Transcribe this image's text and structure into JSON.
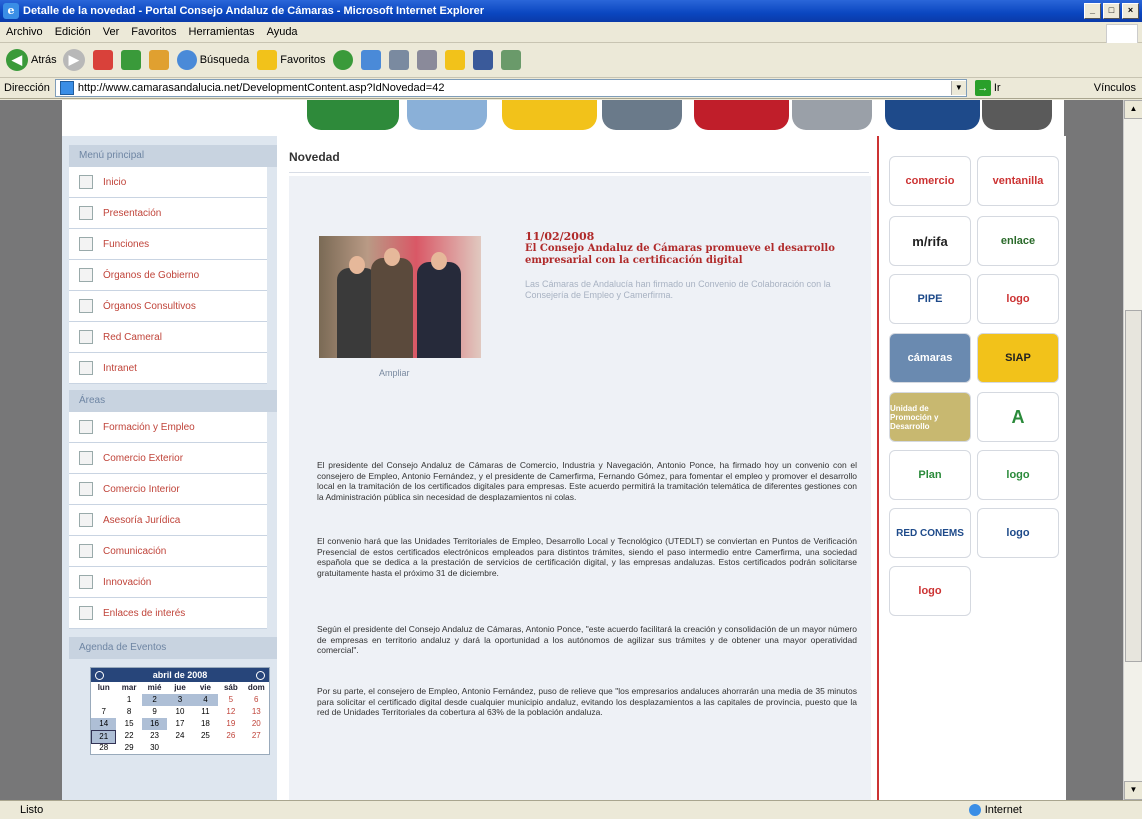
{
  "window": {
    "title": "Detalle de la novedad - Portal Consejo Andaluz de Cámaras - Microsoft Internet Explorer",
    "controls": [
      "_",
      "□",
      "×"
    ]
  },
  "menubar": [
    "Archivo",
    "Edición",
    "Ver",
    "Favoritos",
    "Herramientas",
    "Ayuda"
  ],
  "toolbar": {
    "back": "Atrás",
    "search": "Búsqueda",
    "favorites": "Favoritos"
  },
  "address": {
    "label": "Dirección",
    "url": "http://www.camarasandalucia.net/DevelopmentContent.asp?IdNovedad=42",
    "go": "Ir",
    "links": "Vínculos"
  },
  "sidebar": {
    "main_header": "Menú principal",
    "main_items": [
      {
        "label": "Inicio"
      },
      {
        "label": "Presentación"
      },
      {
        "label": "Funciones"
      },
      {
        "label": "Órganos de Gobierno"
      },
      {
        "label": "Órganos Consultivos"
      },
      {
        "label": "Red Cameral"
      },
      {
        "label": "Intranet"
      }
    ],
    "areas_header": "Áreas",
    "area_items": [
      {
        "label": "Formación y Empleo"
      },
      {
        "label": "Comercio Exterior"
      },
      {
        "label": "Comercio Interior"
      },
      {
        "label": "Asesoría Jurídica"
      },
      {
        "label": "Comunicación"
      },
      {
        "label": "Innovación"
      },
      {
        "label": "Enlaces de interés"
      }
    ],
    "events_header": "Agenda de Eventos",
    "calendar": {
      "month": "abril de 2008",
      "days": [
        "lun",
        "mar",
        "mié",
        "jue",
        "vie",
        "sáb",
        "dom"
      ],
      "weeks": [
        [
          "",
          "1",
          "2",
          "3",
          "4",
          "5",
          "6"
        ],
        [
          "7",
          "8",
          "9",
          "10",
          "11",
          "12",
          "13"
        ],
        [
          "14",
          "15",
          "16",
          "17",
          "18",
          "19",
          "20"
        ],
        [
          "21",
          "22",
          "23",
          "24",
          "25",
          "26",
          "27"
        ],
        [
          "28",
          "29",
          "30",
          "",
          "",
          "",
          ""
        ]
      ]
    }
  },
  "main": {
    "title": "Novedad",
    "photo_caption": "Ampliar",
    "date": "11/02/2008",
    "headline": "El Consejo Andaluz de Cámaras promueve el desarrollo empresarial con la certificación digital",
    "subtitle": "Las Cámaras de Andalucía han firmado un Convenio de Colaboración con la Consejería de Empleo y Camerfirma.",
    "paragraphs": [
      "El presidente del Consejo Andaluz de Cámaras de Comercio, Industria y Navegación, Antonio Ponce, ha firmado hoy un convenio con el consejero de Empleo, Antonio Fernández, y el presidente de Camerfirma, Fernando Gómez, para fomentar el empleo y promover el desarrollo local en la tramitación de los certificados digitales para empresas. Este acuerdo permitirá la tramitación telemática de diferentes gestiones con la Administración pública sin necesidad de desplazamientos ni colas.",
      "El convenio hará que las Unidades Territoriales de Empleo, Desarrollo Local y Tecnológico (UTEDLT) se conviertan en Puntos de Verificación Presencial de estos certificados electrónicos empleados para distintos trámites, siendo el paso intermedio entre Camerfirma, una sociedad española que se dedica a la prestación de servicios de certificación digital, y las empresas andaluzas. Estos certificados podrán solicitarse gratuitamente hasta el próximo 31 de diciembre.",
      "Según el presidente del Consejo Andaluz de Cámaras, Antonio Ponce, \"este acuerdo facilitará la creación y consolidación de un mayor número de empresas en territorio andaluz y dará la oportunidad a los autónomos de agilizar sus trámites y de obtener una mayor operatividad comercial\".",
      "Por su parte, el consejero de Empleo, Antonio Fernández, puso de relieve que \"los empresarios andaluces ahorrarán una media de 35 minutos para solicitar el certificado digital desde cualquier municipio andaluz, evitando los desplazamientos a las capitales de provincia, puesto que la red de Unidades Territoriales da cobertura al 63% de la población andaluza."
    ]
  },
  "right_logos": [
    "comercio",
    "ventanilla",
    "m/rifa",
    "enlace",
    "PIPE",
    "logo",
    "cámaras",
    "SIAP",
    "Unidad de Promoción y Desarrollo",
    "A",
    "Plan",
    "logo",
    "RED CONEMS",
    "logo",
    "logo"
  ],
  "status": {
    "left": "Listo",
    "zone": "Internet"
  }
}
